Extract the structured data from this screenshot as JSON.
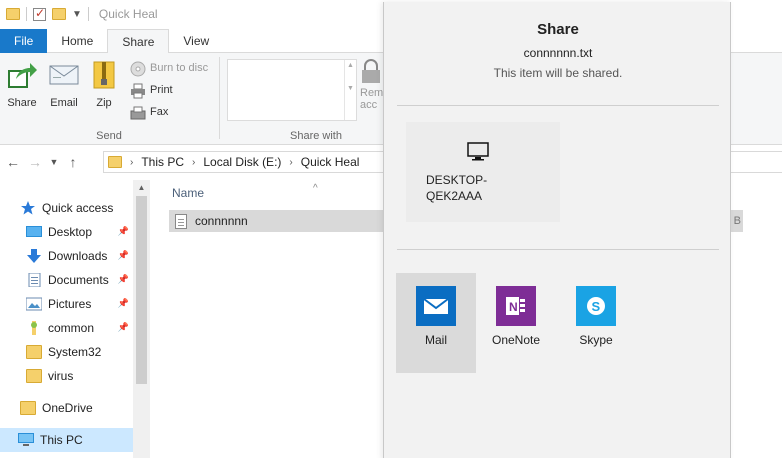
{
  "window": {
    "title": "Quick Heal"
  },
  "ribbon": {
    "tabs": [
      {
        "label": "File"
      },
      {
        "label": "Home"
      },
      {
        "label": "Share"
      },
      {
        "label": "View"
      }
    ],
    "send_group": {
      "label": "Send",
      "share_label": "Share",
      "email_label": "Email",
      "zip_label": "Zip",
      "burn_label": "Burn to disc",
      "print_label": "Print",
      "fax_label": "Fax"
    },
    "share_with_group": {
      "label": "Share with"
    },
    "remove_access_label": "Rem\nacc"
  },
  "address": {
    "crumbs": [
      "This PC",
      "Local Disk (E:)",
      "Quick Heal"
    ]
  },
  "nav_pane": {
    "items": [
      {
        "label": "Quick access",
        "icon": "star-icon"
      },
      {
        "label": "Desktop",
        "icon": "desktop-folder-icon",
        "pinned": true
      },
      {
        "label": "Downloads",
        "icon": "download-icon",
        "pinned": true
      },
      {
        "label": "Documents",
        "icon": "documents-icon",
        "pinned": true
      },
      {
        "label": "Pictures",
        "icon": "pictures-icon",
        "pinned": true
      },
      {
        "label": "common",
        "icon": "folder-icon",
        "pinned": true
      },
      {
        "label": "System32",
        "icon": "folder-icon"
      },
      {
        "label": "virus",
        "icon": "folder-icon"
      },
      {
        "label": "OneDrive",
        "icon": "onedrive-icon"
      },
      {
        "label": "This PC",
        "icon": "computer-icon",
        "selected": true
      }
    ]
  },
  "file_list": {
    "column_name": "Name",
    "files": [
      {
        "name": "connnnnn",
        "size_suffix": "B"
      }
    ]
  },
  "share_panel": {
    "title": "Share",
    "filename": "connnnnn.txt",
    "subtitle": "This item will be shared.",
    "device": {
      "name": "DESKTOP-QEK2AAA"
    },
    "apps": [
      {
        "label": "Mail",
        "color": "#0a6dc2",
        "icon": "mail-icon",
        "selected": true
      },
      {
        "label": "OneNote",
        "color": "#7e2d96",
        "icon": "onenote-icon"
      },
      {
        "label": "Skype",
        "color": "#1aa3e4",
        "icon": "skype-icon"
      }
    ]
  }
}
